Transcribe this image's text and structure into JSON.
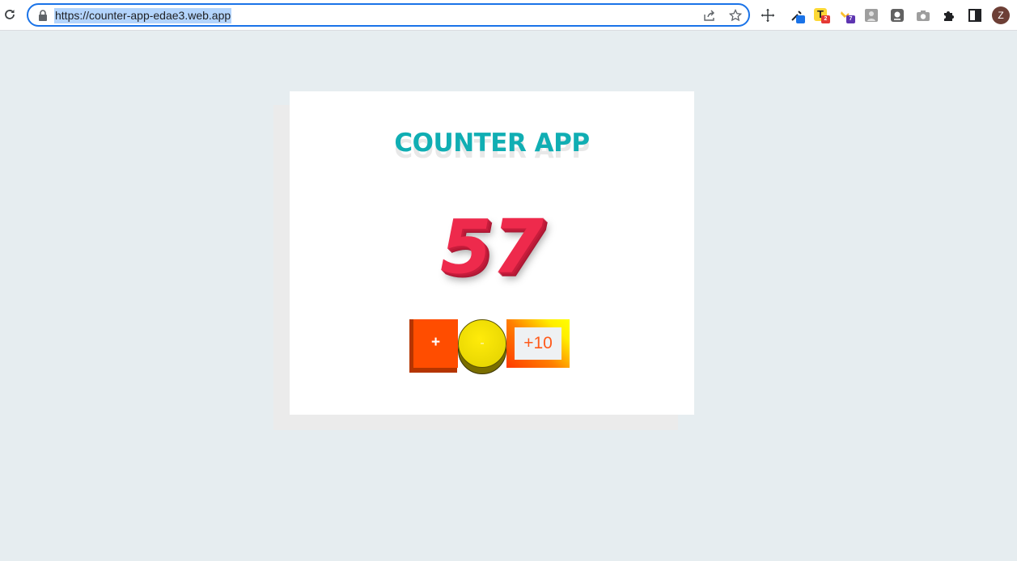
{
  "browser": {
    "url": "https://counter-app-edae3.web.app",
    "extensions": [
      {
        "name": "move-icon"
      },
      {
        "name": "eyedropper-icon",
        "badge_color": "#1a73e8"
      },
      {
        "name": "text-t-icon",
        "badge": "2",
        "badge_color": "#e53935"
      },
      {
        "name": "highlighter-icon",
        "badge": "7",
        "badge_color": "#5e35b1"
      },
      {
        "name": "gallery-icon"
      },
      {
        "name": "contact-icon"
      },
      {
        "name": "camera-icon"
      },
      {
        "name": "puzzle-icon"
      },
      {
        "name": "sidepanel-icon"
      }
    ],
    "avatar_letter": "Z"
  },
  "app": {
    "title": "COUNTER APP",
    "count": "57",
    "buttons": {
      "increment": "+",
      "decrement": "-",
      "add_ten": "+10"
    }
  },
  "colors": {
    "title": "#10aeb3",
    "count": "#ee2a4c",
    "increment": "#ff4d00",
    "decrement": "#ffeb0a",
    "background": "#e6edf0"
  }
}
